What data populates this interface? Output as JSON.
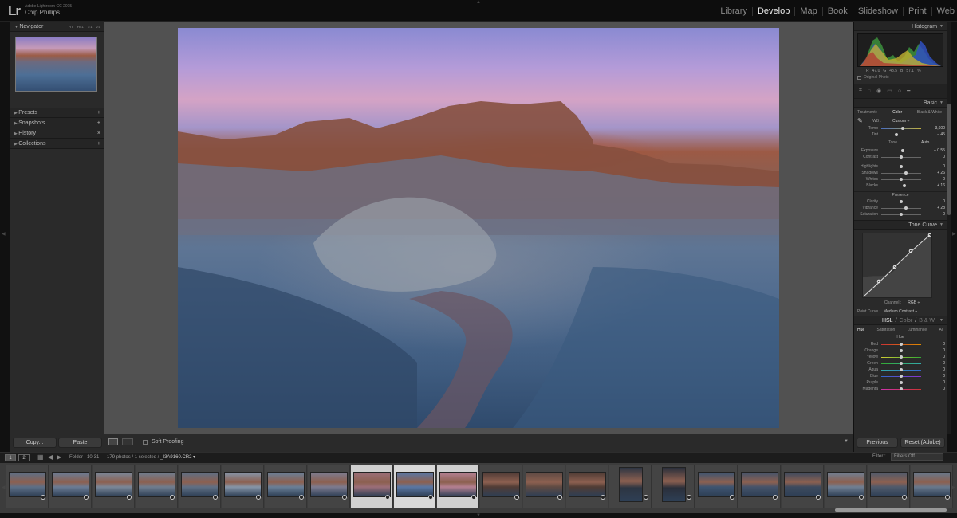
{
  "app": {
    "logo": "Lr",
    "product": "Adobe Lightroom CC 2015",
    "user": "Chip Phillips"
  },
  "modules": [
    {
      "label": "Library",
      "active": false
    },
    {
      "label": "Develop",
      "active": true
    },
    {
      "label": "Map",
      "active": false
    },
    {
      "label": "Book",
      "active": false
    },
    {
      "label": "Slideshow",
      "active": false
    },
    {
      "label": "Print",
      "active": false
    },
    {
      "label": "Web",
      "active": false
    }
  ],
  "left_panel": {
    "navigator": {
      "title": "Navigator",
      "zoom_options": [
        "FIT",
        "FILL",
        "1:1",
        "2:1"
      ]
    },
    "sections": [
      {
        "title": "Presets",
        "action": "+"
      },
      {
        "title": "Snapshots",
        "action": "+"
      },
      {
        "title": "History",
        "action": "×"
      },
      {
        "title": "Collections",
        "action": "+"
      }
    ],
    "copy_label": "Copy...",
    "paste_label": "Paste"
  },
  "toolbar": {
    "soft_proofing": "Soft Proofing"
  },
  "right_panel": {
    "histogram_title": "Histogram",
    "rgb": {
      "r_label": "R",
      "r": "47.0",
      "g_label": "G",
      "g": "48.5",
      "b_label": "B",
      "b": "57.1",
      "unit": "%"
    },
    "original_photo": "Original Photo",
    "basic": {
      "title": "Basic",
      "treatment_label": "Treatment :",
      "treatment_color": "Color",
      "treatment_bw": "Black & White",
      "wb_label": "WB :",
      "wb_value": "Custom ÷",
      "temp": {
        "label": "Temp",
        "value": "3,600",
        "pos": 0.55
      },
      "tint": {
        "label": "Tint",
        "value": "− 45",
        "pos": 0.38
      },
      "tone_label": "Tone",
      "auto_label": "Auto",
      "exposure": {
        "label": "Exposure",
        "value": "+ 0.55",
        "pos": 0.55
      },
      "contrast": {
        "label": "Contrast",
        "value": "0",
        "pos": 0.5
      },
      "highlights": {
        "label": "Highlights",
        "value": "0",
        "pos": 0.5
      },
      "shadows": {
        "label": "Shadows",
        "value": "+ 26",
        "pos": 0.63
      },
      "whites": {
        "label": "Whites",
        "value": "0",
        "pos": 0.5
      },
      "blacks": {
        "label": "Blacks",
        "value": "+ 16",
        "pos": 0.58
      },
      "presence_label": "Presence",
      "clarity": {
        "label": "Clarity",
        "value": "0",
        "pos": 0.5
      },
      "vibrance": {
        "label": "Vibrance",
        "value": "+ 28",
        "pos": 0.64
      },
      "saturation": {
        "label": "Saturation",
        "value": "0",
        "pos": 0.5
      }
    },
    "tone_curve": {
      "title": "Tone Curve",
      "channel_label": "Channel :",
      "channel_value": "RGB ÷",
      "point_curve_label": "Point Curve :",
      "point_curve_value": "Medium Contrast ÷"
    },
    "hsl": {
      "title_hsl": "HSL",
      "sep": "/",
      "title_color": "Color",
      "title_bw": "B & W",
      "tabs": [
        "Hue",
        "Saturation",
        "Luminance",
        "All"
      ],
      "subtitle": "Hue",
      "rows": [
        {
          "label": "Red",
          "value": "0"
        },
        {
          "label": "Orange",
          "value": "0"
        },
        {
          "label": "Yellow",
          "value": "0"
        },
        {
          "label": "Green",
          "value": "0"
        },
        {
          "label": "Aqua",
          "value": "0"
        },
        {
          "label": "Blue",
          "value": "0"
        },
        {
          "label": "Purple",
          "value": "0"
        },
        {
          "label": "Magenta",
          "value": "0"
        }
      ]
    },
    "previous_label": "Previous",
    "reset_label": "Reset (Adobe)"
  },
  "filmstrip_bar": {
    "page1": "1",
    "page2": "2",
    "folder": "Folder : 10-31",
    "count": "179 photos / 1 selected /",
    "filename": "_I3A9160.CR2 ▾",
    "filter_label": "Filter :",
    "filter_value": "Filters Off"
  },
  "colors": {
    "accent": "#e6e6e6",
    "panel": "#2a2a2a",
    "bg": "#111111"
  }
}
